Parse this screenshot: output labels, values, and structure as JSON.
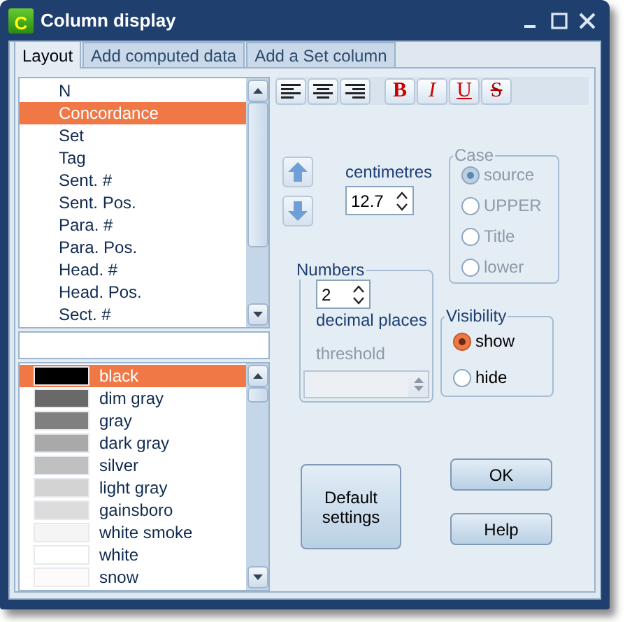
{
  "window": {
    "icon_text": "C",
    "title": "Column display"
  },
  "tabs": [
    {
      "label": "Layout",
      "selected": true
    },
    {
      "label": "Add computed data",
      "selected": false
    },
    {
      "label": "Add a Set column",
      "selected": false
    }
  ],
  "columns_list": [
    {
      "label": "N",
      "selected": false
    },
    {
      "label": "Concordance",
      "selected": true
    },
    {
      "label": "Set",
      "selected": false
    },
    {
      "label": "Tag",
      "selected": false
    },
    {
      "label": "Sent. #",
      "selected": false
    },
    {
      "label": "Sent. Pos.",
      "selected": false
    },
    {
      "label": "Para. #",
      "selected": false
    },
    {
      "label": "Para. Pos.",
      "selected": false
    },
    {
      "label": "Head. #",
      "selected": false
    },
    {
      "label": "Head. Pos.",
      "selected": false
    },
    {
      "label": "Sect. #",
      "selected": false
    }
  ],
  "colors_list": [
    {
      "name": "black",
      "color": "#000000",
      "selected": true
    },
    {
      "name": "dim gray",
      "color": "#696969",
      "selected": false
    },
    {
      "name": "gray",
      "color": "#808080",
      "selected": false
    },
    {
      "name": "dark gray",
      "color": "#a9a9a9",
      "selected": false
    },
    {
      "name": "silver",
      "color": "#c0c0c0",
      "selected": false
    },
    {
      "name": "light gray",
      "color": "#d3d3d3",
      "selected": false
    },
    {
      "name": "gainsboro",
      "color": "#dcdcdc",
      "selected": false
    },
    {
      "name": "white smoke",
      "color": "#f5f5f5",
      "selected": false
    },
    {
      "name": "white",
      "color": "#ffffff",
      "selected": false
    },
    {
      "name": "snow",
      "color": "#fffafa",
      "selected": false
    }
  ],
  "format_toolbar": [
    {
      "kind": "align-left"
    },
    {
      "kind": "align-center"
    },
    {
      "kind": "align-right"
    },
    {
      "kind": "bold",
      "label": "B"
    },
    {
      "kind": "italic",
      "label": "I"
    },
    {
      "kind": "underline",
      "label": "U"
    },
    {
      "kind": "strike",
      "label": "S"
    }
  ],
  "width": {
    "label": "centimetres",
    "value": "12.7"
  },
  "case": {
    "title": "Case",
    "disabled": true,
    "options": [
      {
        "label": "source",
        "selected": true
      },
      {
        "label": "UPPER",
        "selected": false
      },
      {
        "label": "Title",
        "selected": false
      },
      {
        "label": "lower",
        "selected": false
      }
    ]
  },
  "numbers": {
    "title": "Numbers",
    "value": "2",
    "label": "decimal places",
    "threshold_label": "threshold",
    "threshold_disabled": true
  },
  "visibility": {
    "title": "Visibility",
    "disabled": false,
    "options": [
      {
        "label": "show",
        "selected": true
      },
      {
        "label": "hide",
        "selected": false
      }
    ]
  },
  "buttons": [
    {
      "kind": "default",
      "label": "Default settings"
    },
    {
      "kind": "ok",
      "label": "OK"
    },
    {
      "kind": "help",
      "label": "Help"
    }
  ]
}
